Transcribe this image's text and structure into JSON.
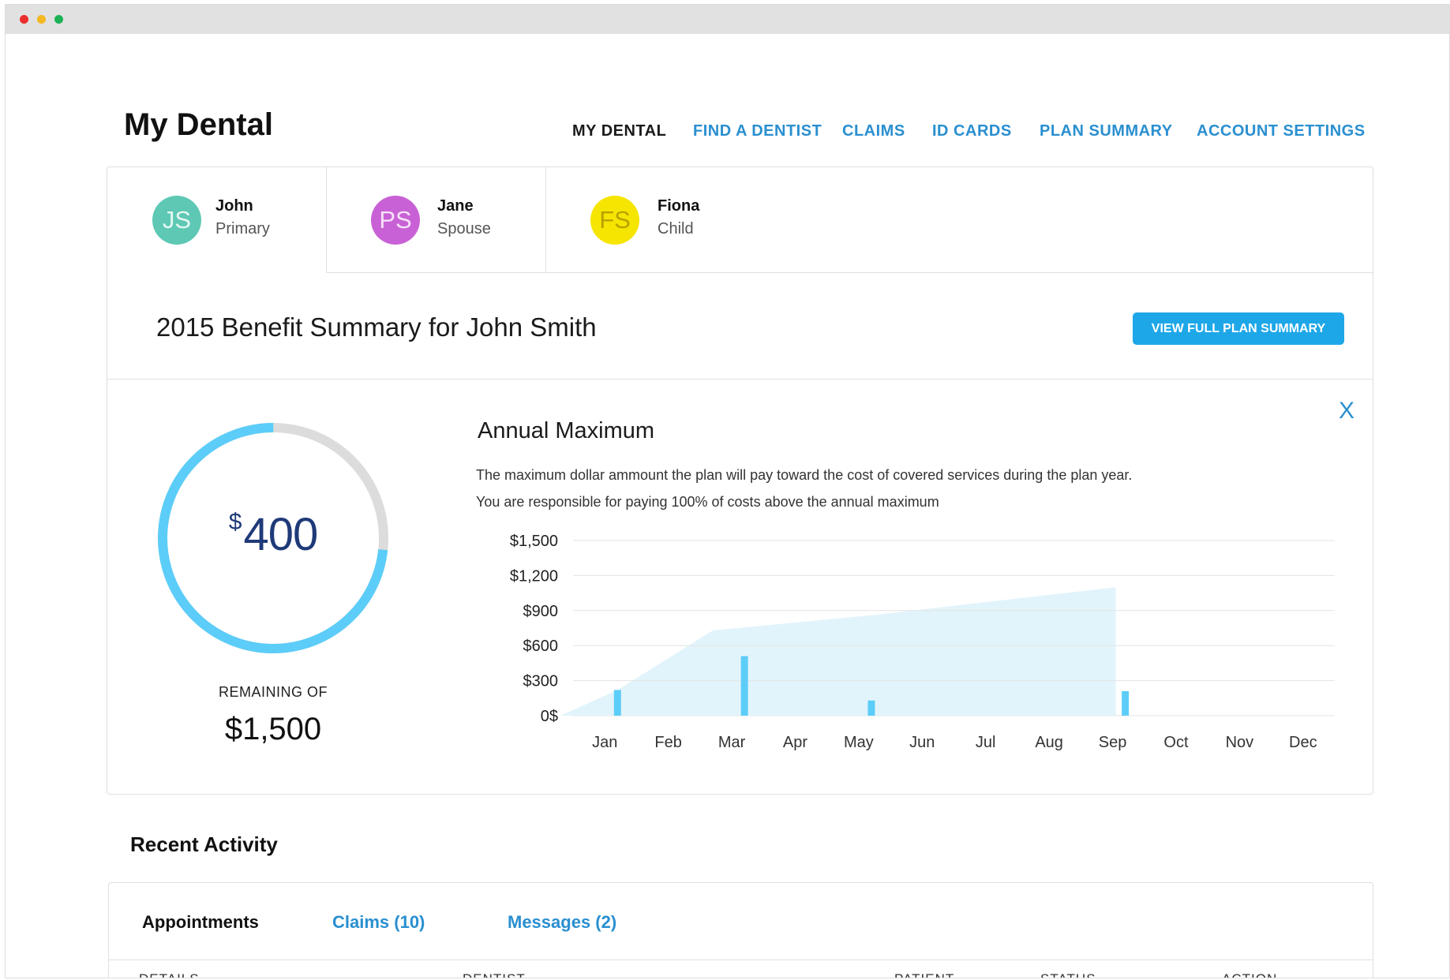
{
  "app": {
    "title": "My Dental"
  },
  "nav": [
    {
      "label": "MY DENTAL",
      "active": true
    },
    {
      "label": "FIND A DENTIST",
      "active": false
    },
    {
      "label": "CLAIMS",
      "active": false
    },
    {
      "label": "ID CARDS",
      "active": false
    },
    {
      "label": "PLAN SUMMARY",
      "active": false
    },
    {
      "label": "ACCOUNT SETTINGS",
      "active": false
    }
  ],
  "members": [
    {
      "initials": "JS",
      "name": "John",
      "role": "Primary",
      "color": "#5ec8b4",
      "text_color": "#e6f7f3",
      "active": true
    },
    {
      "initials": "PS",
      "name": "Jane",
      "role": "Spouse",
      "color": "#c961d6",
      "text_color": "#f6e2f9",
      "active": false
    },
    {
      "initials": "FS",
      "name": "Fiona",
      "role": "Child",
      "color": "#f6e500",
      "text_color": "#b8a300",
      "active": false
    }
  ],
  "summary": {
    "title": "2015 Benefit Summary for John Smith",
    "button_label": "VIEW FULL PLAN SUMMARY"
  },
  "annual_max": {
    "currency_symbol": "$",
    "remaining": "400",
    "remaining_value": 400,
    "total_value": 1500,
    "remaining_label": "REMAINING OF",
    "total": "$1,500",
    "ring_color": "#5ccdf8",
    "ring_track_color": "#dcdcdc",
    "close_label": "X",
    "title": "Annual Maximum",
    "description_line1": "The maximum dollar ammount the plan will pay toward the cost of covered services during the plan year.",
    "description_line2": "You are responsible for paying 100% of costs above the annual maximum"
  },
  "chart_data": {
    "type": "bar",
    "categories": [
      "Jan",
      "Feb",
      "Mar",
      "Apr",
      "May",
      "Jun",
      "Jul",
      "Aug",
      "Sep",
      "Oct",
      "Nov",
      "Dec"
    ],
    "y_tick_labels": [
      "0$",
      "$300",
      "$600",
      "$900",
      "$1,200",
      "$1,500"
    ],
    "y_ticks": [
      0,
      300,
      600,
      900,
      1200,
      1500
    ],
    "ylim": [
      0,
      1500
    ],
    "grid": true,
    "bars": [
      {
        "month": "Jan",
        "value": 220
      },
      {
        "month": "Mar",
        "value": 510
      },
      {
        "month": "May",
        "value": 130
      },
      {
        "month": "Sep",
        "value": 210
      }
    ],
    "cumulative_area": [
      {
        "month": "Jan",
        "value": 0,
        "offset": -0.7
      },
      {
        "month": "Jan",
        "value": 220,
        "offset": 0.2
      },
      {
        "month": "Mar",
        "value": 730,
        "offset": -0.3
      },
      {
        "month": "May",
        "value": 860,
        "offset": 0.2
      },
      {
        "month": "Sep",
        "value": 1100,
        "offset": 0.05
      }
    ],
    "bar_color": "#5ccdf8",
    "area_color": "#e2f4fb",
    "grid_color": "#e3e3e3"
  },
  "recent_activity": {
    "title": "Recent Activity",
    "tabs": [
      {
        "label": "Appointments",
        "active": true
      },
      {
        "label": "Claims (10)",
        "active": false
      },
      {
        "label": "Messages (2)",
        "active": false
      }
    ],
    "columns": [
      "DETAILS",
      "DENTIST",
      "PATIENT",
      "STATUS",
      "ACTION"
    ]
  }
}
